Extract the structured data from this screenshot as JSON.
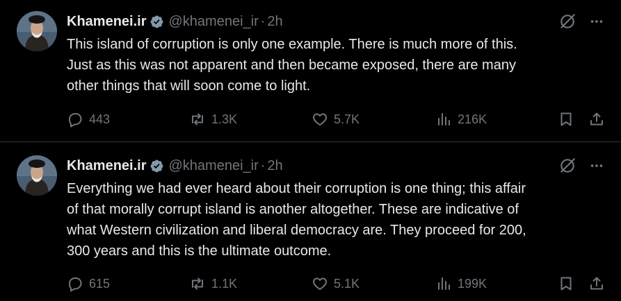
{
  "tweets": [
    {
      "author_name": "Khamenei.ir",
      "handle": "@khamenei_ir",
      "separator": "·",
      "time": "2h",
      "lines": [
        "This island of corruption is only one example. There is much more of this.",
        "Just as this was not apparent and then became exposed, there are many",
        "other things that will soon come to light."
      ],
      "replies": "443",
      "reposts": "1.3K",
      "likes": "5.7K",
      "views": "216K"
    },
    {
      "author_name": "Khamenei.ir",
      "handle": "@khamenei_ir",
      "separator": "·",
      "time": "2h",
      "lines": [
        "Everything we had ever heard about their corruption is one thing; this affair",
        "of that morally corrupt island is another altogether. These are indicative of",
        "what Western civilization and liberal democracy are. They proceed for 200,",
        "300 years and this is the ultimate outcome."
      ],
      "replies": "615",
      "reposts": "1.1K",
      "likes": "5.1K",
      "views": "199K"
    }
  ],
  "colors": {
    "background": "#000000",
    "text": "#e7e9ea",
    "muted": "#71767b",
    "verified": "#829aab",
    "divider": "#2f3336"
  },
  "icons": [
    "verified-badge-icon",
    "grok-icon",
    "more-icon",
    "reply-icon",
    "repost-icon",
    "like-icon",
    "views-icon",
    "bookmark-icon",
    "share-icon"
  ]
}
